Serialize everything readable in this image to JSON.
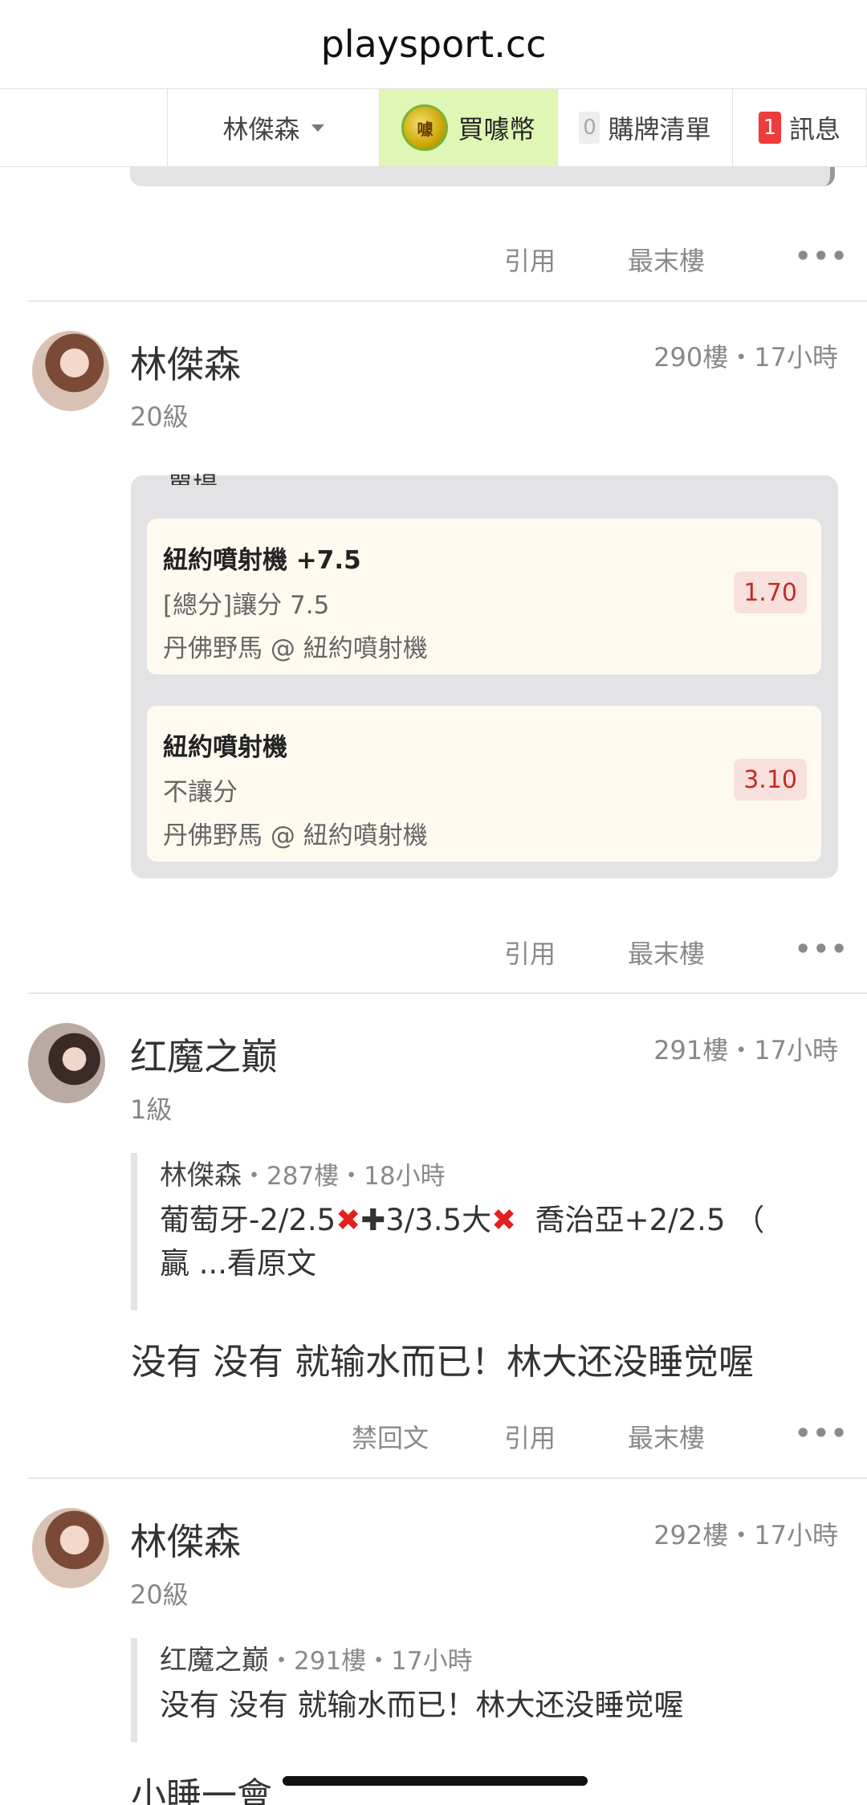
{
  "url": "playsport.cc",
  "nav": {
    "user": "林傑森",
    "coin_icon_text": "噱",
    "buy": "買噱幣",
    "cart_count": "0",
    "cart": "購牌清單",
    "msg_count": "1",
    "msg": "訊息"
  },
  "actions": {
    "quote": "引用",
    "last": "最末樓",
    "more": "•••",
    "ban": "禁回文"
  },
  "posts": [
    {
      "name": "林傑森",
      "level": "20級",
      "floor": "290樓・17小時",
      "cut_label": "單場",
      "bets": [
        {
          "title": "紐約噴射機 +7.5",
          "type": "[總分]讓分 7.5",
          "match": "丹佛野馬 @ 紐約噴射機",
          "odds": "1.70"
        },
        {
          "title": "紐約噴射機",
          "type": "不讓分",
          "match": "丹佛野馬 @ 紐約噴射機",
          "odds": "3.10"
        }
      ]
    },
    {
      "name": "红魔之巅",
      "level": "1級",
      "floor": "291樓・17小時",
      "quote_name": "林傑森",
      "quote_meta": "・287樓・18小時",
      "quote_line1_a": "葡萄牙-2/2.5",
      "quote_line1_b": "3/3.5大",
      "quote_line1_c": "  喬治亞+2/2.5 （",
      "quote_line2": "贏 ...看原文",
      "content": "没有 没有 就输水而已！林大还没睡觉喔"
    },
    {
      "name": "林傑森",
      "level": "20級",
      "floor": "292樓・17小時",
      "quote_name": "红魔之巅",
      "quote_meta": "・291樓・17小時",
      "quote_line1": "没有 没有 就输水而已！林大还没睡觉喔",
      "content": "小睡一會"
    }
  ]
}
